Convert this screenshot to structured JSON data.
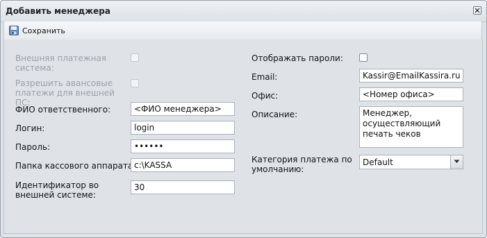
{
  "window": {
    "title": "Добавить менеджера"
  },
  "toolbar": {
    "save_label": "Сохранить"
  },
  "left": {
    "external_system_label": "Внешняя платежная система:",
    "external_system_checked": false,
    "allow_advance_label": "Разрешить авансовые платежи для внешней ПС:",
    "allow_advance_checked": false,
    "fio_label": "ФИО ответственного:",
    "fio_value": "<ФИО менеджера>",
    "login_label": "Логин:",
    "login_value": "login",
    "password_label": "Пароль:",
    "password_value": "••••••",
    "folder_label": "Папка кассового аппарата:",
    "folder_value": "c:\\KASSA",
    "ext_id_label": "Идентификатор во внешней системе:",
    "ext_id_value": "30"
  },
  "right": {
    "show_passwords_label": "Отображать пароли:",
    "show_passwords_checked": false,
    "email_label": "Email:",
    "email_value": "Kassir@EmailKassira.ru",
    "office_label": "Офис:",
    "office_value": "<Номер офиса>",
    "description_label": "Описание:",
    "description_value": "Менеджер, осуществляющий печать чеков",
    "category_label": "Категория платежа по умолчанию:",
    "category_value": "Default"
  },
  "icons": {
    "save": "save-icon",
    "close": "close-icon",
    "dropdown": "chevron-down-icon"
  }
}
